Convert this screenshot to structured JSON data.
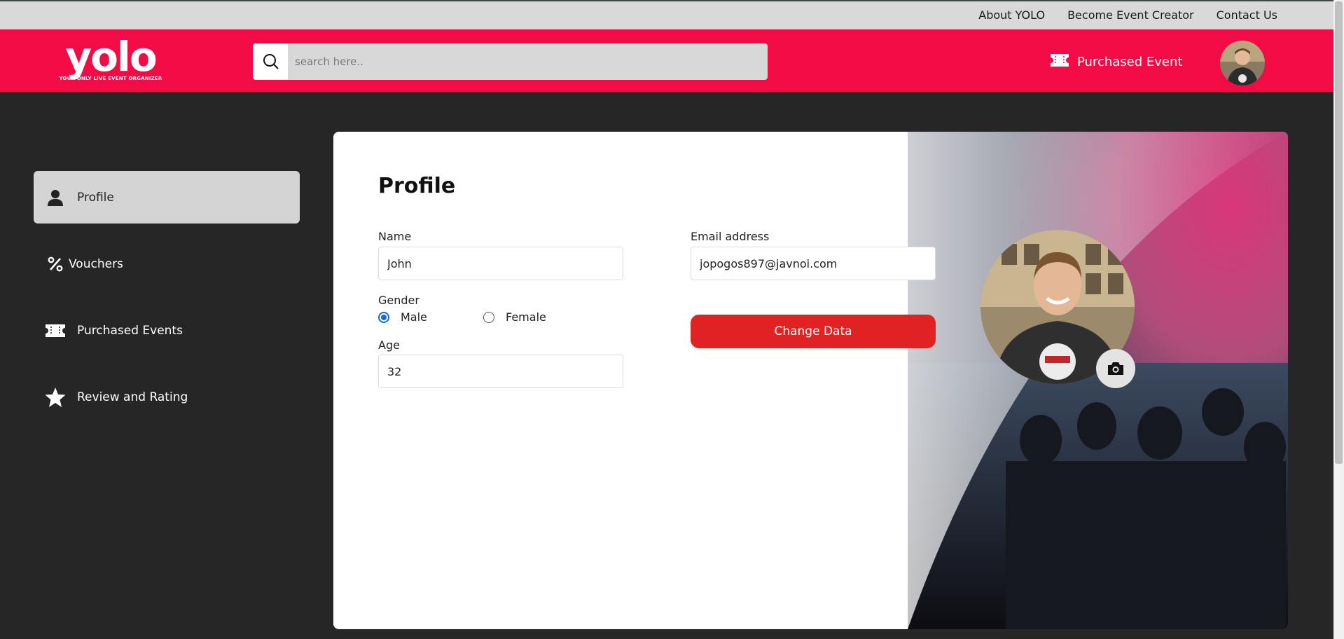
{
  "topnav": {
    "about": "About YOLO",
    "creator": "Become Event Creator",
    "contact": "Contact Us"
  },
  "header": {
    "logo_text": "yolo",
    "logo_tagline": "YOUR ONLY LIVE EVENT ORGANIZER",
    "search_placeholder": "search here..",
    "purchased_label": "Purchased Event"
  },
  "sidebar": {
    "items": [
      {
        "label": "Profile",
        "icon": "person-icon",
        "active": true
      },
      {
        "label": "Vouchers",
        "icon": "percent-icon"
      },
      {
        "label": "Purchased Events",
        "icon": "ticket-icon"
      },
      {
        "label": "Review and Rating",
        "icon": "star-icon"
      }
    ]
  },
  "profile": {
    "title": "Profile",
    "name_label": "Name",
    "name_value": "John",
    "email_label": "Email address",
    "email_value": "jopogos897@javnoi.com",
    "gender_label": "Gender",
    "gender_options": [
      "Male",
      "Female"
    ],
    "gender_selected": "Male",
    "age_label": "Age",
    "age_value": "32",
    "change_button": "Change Data"
  },
  "colors": {
    "brand": "#f20b45",
    "button": "#e02222",
    "radio": "#1a66e0",
    "page_bg": "#262626"
  }
}
